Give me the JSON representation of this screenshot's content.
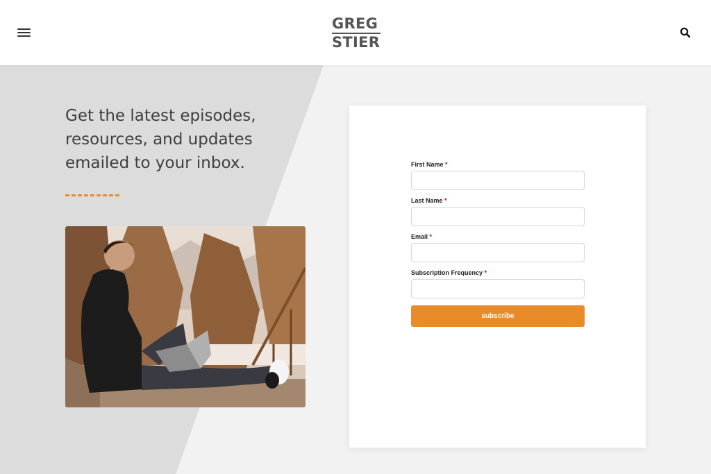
{
  "header": {
    "menu_icon": "hamburger-menu-icon",
    "logo_line1": "GREG",
    "logo_line2": "STIER",
    "search_icon": "search-icon"
  },
  "hero": {
    "headline": "Get the latest episodes, resources, and updates emailed to your inbox.",
    "accent_color": "#e98b29",
    "photo_icon": "person-with-laptop-photo"
  },
  "form": {
    "fields": [
      {
        "label": "First Name",
        "required_mark": "*",
        "value": ""
      },
      {
        "label": "Last Name",
        "required_mark": "*",
        "value": ""
      },
      {
        "label": "Email",
        "required_mark": "*",
        "value": ""
      },
      {
        "label": "Subscription Frequency",
        "required_mark": "*",
        "value": ""
      }
    ],
    "submit_label": "subscribe",
    "button_color": "#e98b29"
  }
}
